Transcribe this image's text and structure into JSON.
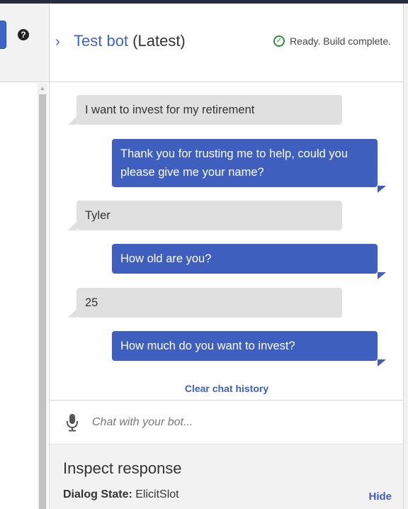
{
  "header": {
    "title_name": "Test bot",
    "title_tag": "(Latest)",
    "status": "Ready. Build complete.",
    "help_glyph": "?"
  },
  "chat": {
    "messages": [
      {
        "role": "user",
        "text": "I want to invest for my retirement"
      },
      {
        "role": "bot",
        "text": "Thank you for trusting me to help, could you please give me your name?"
      },
      {
        "role": "user",
        "text": "Tyler"
      },
      {
        "role": "bot",
        "text": "How old are you?"
      },
      {
        "role": "user",
        "text": "25"
      },
      {
        "role": "bot",
        "text": "How much do you want to invest?"
      }
    ],
    "clear_history": "Clear chat history",
    "input_placeholder": "Chat with your bot...",
    "input_value": ""
  },
  "inspect": {
    "title": "Inspect response",
    "dialog_state_label": "Dialog State:",
    "dialog_state_value": "ElicitSlot",
    "hide_label": "Hide"
  },
  "icons": {
    "chevron": "chevron-right-icon",
    "status": "check-circle-icon",
    "microphone": "microphone-icon",
    "help": "help-icon"
  },
  "colors": {
    "accent": "#3f5fbf",
    "success": "#2e8b3a",
    "user_bubble": "#e0e0e0",
    "topbar": "#232f3e"
  }
}
